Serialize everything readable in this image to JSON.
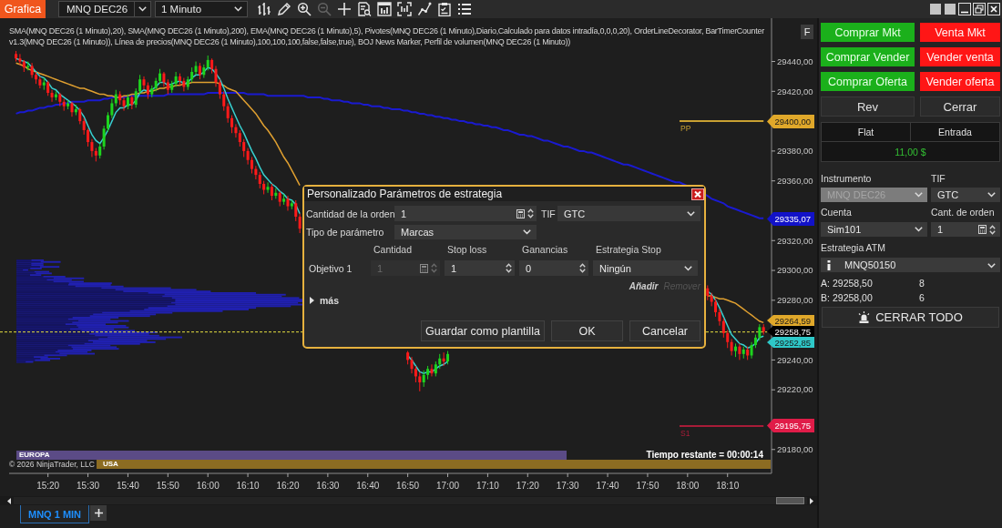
{
  "toolbar": {
    "tab": "Grafica",
    "instrument": "MNQ DEC26",
    "interval": "1 Minuto",
    "tools": [
      {
        "disabled": false
      },
      {
        "disabled": false
      },
      {
        "disabled": false
      },
      {
        "disabled": true
      },
      {
        "disabled": false
      },
      {
        "disabled": false
      },
      {
        "disabled": false
      },
      {
        "disabled": false
      },
      {
        "disabled": false
      },
      {
        "disabled": false
      },
      {
        "disabled": false
      }
    ]
  },
  "chart": {
    "indicators": "SMA(MNQ DEC26 (1 Minuto),20), SMA(MNQ DEC26 (1 Minuto),200), EMA(MNQ DEC26 (1 Minuto),5), Pivotes(MNQ DEC26 (1 Minuto),Diario,Calculado para datos intradía,0,0,0,20), OrderLineDecorator, BarTimerCounter v1.3(MNQ DEC26 (1 Minuto)), Línea de precios(MNQ DEC26 (1 Minuto),100,100,100,false,false,true), BOJ News Marker, Perfil de volumen(MNQ DEC26 (1 Minuto))",
    "panel_button": "F",
    "chart_data": {
      "type": "candlestick",
      "x": [
        912,
        913,
        914,
        915,
        916,
        917,
        918,
        919,
        920,
        921,
        922,
        923,
        924,
        925,
        926,
        927,
        928,
        929,
        930,
        931,
        932,
        933,
        934,
        935,
        936,
        937,
        938,
        939,
        940,
        941,
        942,
        943,
        944,
        945,
        946,
        947,
        948,
        949,
        950,
        951,
        952,
        953,
        954,
        955,
        956,
        957,
        958,
        959,
        960,
        961,
        962,
        963,
        964,
        965,
        966,
        967,
        968,
        969,
        970,
        971,
        972,
        973,
        974,
        975,
        976,
        977,
        978,
        979,
        980,
        981,
        982,
        983,
        984,
        985,
        986,
        987,
        988,
        989,
        990,
        991,
        992,
        993,
        994,
        995,
        996,
        997,
        998,
        999,
        1000,
        1001,
        1002,
        1003,
        1004,
        1005,
        1006,
        1007,
        1008,
        1009,
        1010,
        1011,
        1012,
        1013,
        1014,
        1015,
        1016,
        1017,
        1018,
        1019,
        1020,
        1021,
        1022,
        1023,
        1024,
        1025,
        1026,
        1027,
        1028,
        1029,
        1030,
        1031,
        1032,
        1033,
        1034,
        1035,
        1036,
        1037,
        1038,
        1039,
        1040,
        1041,
        1042,
        1043,
        1044,
        1045,
        1046,
        1047,
        1048,
        1049,
        1050,
        1051,
        1052,
        1053,
        1054,
        1055,
        1056,
        1057,
        1058,
        1059,
        1060,
        1061,
        1062,
        1063,
        1064,
        1065,
        1066,
        1067,
        1068,
        1069,
        1070,
        1071,
        1072,
        1073,
        1074,
        1075,
        1076,
        1077,
        1078,
        1085,
        1086,
        1087,
        1088,
        1089,
        1090,
        1091,
        1092,
        1093,
        1094,
        1095,
        1096,
        1097,
        1098,
        1099
      ],
      "ohlc": [
        [
          29445,
          29447,
          29440,
          29442
        ],
        [
          29442,
          29445,
          29438,
          29440
        ],
        [
          29440,
          29441,
          29433,
          29436
        ],
        [
          29436,
          29440,
          29434,
          29437
        ],
        [
          29437,
          29439,
          29429,
          29431
        ],
        [
          29431,
          29433,
          29425,
          29428
        ],
        [
          29428,
          29430,
          29422,
          29424
        ],
        [
          29424,
          29429,
          29421,
          29426
        ],
        [
          29426,
          29427,
          29417,
          29419
        ],
        [
          29419,
          29421,
          29413,
          29416
        ],
        [
          29416,
          29420,
          29414,
          29418
        ],
        [
          29418,
          29419,
          29410,
          29413
        ],
        [
          29413,
          29415,
          29407,
          29410
        ],
        [
          29410,
          29414,
          29408,
          29412
        ],
        [
          29412,
          29413,
          29403,
          29406
        ],
        [
          29406,
          29411,
          29404,
          29408
        ],
        [
          29408,
          29409,
          29398,
          29400
        ],
        [
          29400,
          29402,
          29391,
          29394
        ],
        [
          29394,
          29395,
          29383,
          29386
        ],
        [
          29386,
          29388,
          29376,
          29380
        ],
        [
          29380,
          29382,
          29373,
          29377
        ],
        [
          29377,
          29385,
          29375,
          29383
        ],
        [
          29383,
          29397,
          29381,
          29395
        ],
        [
          29395,
          29406,
          29393,
          29404
        ],
        [
          29404,
          29415,
          29402,
          29412
        ],
        [
          29412,
          29421,
          29410,
          29418
        ],
        [
          29418,
          29420,
          29411,
          29414
        ],
        [
          29414,
          29416,
          29407,
          29410
        ],
        [
          29410,
          29418,
          29408,
          29416
        ],
        [
          29416,
          29417,
          29408,
          29411
        ],
        [
          29411,
          29422,
          29409,
          29420
        ],
        [
          29420,
          29431,
          29418,
          29428
        ],
        [
          29428,
          29430,
          29421,
          29424
        ],
        [
          29424,
          29426,
          29415,
          29418
        ],
        [
          29418,
          29424,
          29416,
          29422
        ],
        [
          29422,
          29429,
          29420,
          29427
        ],
        [
          29427,
          29435,
          29425,
          29432
        ],
        [
          29432,
          29433,
          29423,
          29426
        ],
        [
          29426,
          29428,
          29418,
          29421
        ],
        [
          29421,
          29427,
          29419,
          29425
        ],
        [
          29425,
          29433,
          29423,
          29430
        ],
        [
          29430,
          29432,
          29424,
          29427
        ],
        [
          29427,
          29429,
          29420,
          29423
        ],
        [
          29423,
          29430,
          29421,
          29428
        ],
        [
          29428,
          29436,
          29426,
          29433
        ],
        [
          29433,
          29440,
          29431,
          29437
        ],
        [
          29437,
          29439,
          29428,
          29431
        ],
        [
          29431,
          29438,
          29429,
          29436
        ],
        [
          29436,
          29444,
          29434,
          29441
        ],
        [
          29441,
          29442,
          29432,
          29435
        ],
        [
          29435,
          29437,
          29423,
          29426
        ],
        [
          29426,
          29428,
          29415,
          29418
        ],
        [
          29418,
          29420,
          29407,
          29410
        ],
        [
          29410,
          29412,
          29399,
          29402
        ],
        [
          29402,
          29404,
          29392,
          29396
        ],
        [
          29396,
          29398,
          29389,
          29392
        ],
        [
          29392,
          29394,
          29383,
          29386
        ],
        [
          29386,
          29388,
          29376,
          29380
        ],
        [
          29380,
          29382,
          29371,
          29374
        ],
        [
          29374,
          29376,
          29365,
          29368
        ],
        [
          29368,
          29370,
          29361,
          29364
        ],
        [
          29364,
          29366,
          29355,
          29358
        ],
        [
          29358,
          29360,
          29351,
          29354
        ],
        [
          29354,
          29359,
          29352,
          29356
        ],
        [
          29356,
          29358,
          29347,
          29350
        ],
        [
          29350,
          29355,
          29348,
          29352
        ],
        [
          29352,
          29353,
          29343,
          29346
        ],
        [
          29346,
          29351,
          29344,
          29348
        ],
        [
          29348,
          29350,
          29340,
          29343
        ],
        [
          29343,
          29347,
          29341,
          29345
        ],
        [
          29345,
          29347,
          29333,
          29336
        ],
        [
          29336,
          29338,
          29325,
          29328
        ],
        null,
        null,
        null,
        null,
        null,
        null,
        null,
        null,
        null,
        null,
        null,
        null,
        null,
        null,
        null,
        null,
        null,
        null,
        null,
        null,
        null,
        null,
        null,
        null,
        null,
        null,
        [
          29245,
          29246,
          29237,
          29240
        ],
        [
          29240,
          29242,
          29231,
          29234
        ],
        [
          29234,
          29236,
          29225,
          29229
        ],
        [
          29229,
          29232,
          29219,
          29225
        ],
        [
          29225,
          29233,
          29222,
          29230
        ],
        [
          29230,
          29236,
          29227,
          29234
        ],
        [
          29234,
          29237,
          29229,
          29231
        ],
        [
          29231,
          29239,
          29229,
          29237
        ],
        [
          29237,
          29244,
          29234,
          29241
        ],
        [
          29241,
          29245,
          29236,
          29239
        ],
        [
          29239,
          29246,
          29237,
          29244
        ],
        null,
        null,
        null,
        null,
        null,
        null,
        null,
        null,
        null,
        null,
        null,
        null,
        null,
        null,
        null,
        null,
        null,
        null,
        null,
        null,
        null,
        null,
        null,
        null,
        null,
        null,
        null,
        null,
        null,
        null,
        null,
        null,
        null,
        null,
        null,
        null,
        null,
        null,
        null,
        null,
        null,
        null,
        null,
        null,
        null,
        null,
        null,
        null,
        null,
        null,
        null,
        null,
        null,
        null,
        null,
        null,
        null,
        null,
        [
          29288,
          29290,
          29280,
          29283
        ],
        [
          29283,
          29285,
          29276,
          29279
        ],
        [
          29279,
          29281,
          29269,
          29272
        ],
        [
          29272,
          29274,
          29263,
          29266
        ],
        [
          29266,
          29268,
          29255,
          29258
        ],
        [
          29258,
          29260,
          29248,
          29252
        ],
        [
          29252,
          29254,
          29243,
          29246
        ],
        [
          29246,
          29251,
          29242,
          29249
        ],
        [
          29249,
          29251,
          29240,
          29244
        ],
        [
          29244,
          29249,
          29241,
          29247
        ],
        [
          29247,
          29249,
          29240,
          29243
        ],
        [
          29243,
          29252,
          29241,
          29250
        ],
        [
          29250,
          29257,
          29248,
          29255
        ],
        [
          29255,
          29264,
          29253,
          29262
        ],
        [
          29262,
          29264,
          29257,
          29259
        ]
      ],
      "series": [
        {
          "type": "line",
          "color": "#1a1ad0",
          "values": [
            29405,
            29406,
            29406,
            29407,
            29407,
            29408,
            29409,
            29409,
            29410,
            29410,
            29411,
            29411,
            29412,
            29412,
            29413,
            29413,
            29413,
            29413,
            29414,
            29414,
            29414,
            29414,
            29415,
            29415,
            29416,
            29416,
            29416,
            29416,
            29417,
            29417,
            29417,
            29417,
            29417,
            29417,
            29417,
            29417,
            29417,
            29417,
            29418,
            29418,
            29418,
            29418,
            29418,
            29418,
            29418,
            29418,
            29418,
            29418,
            29419,
            29419,
            29419,
            29419,
            29419,
            29419,
            29419,
            29419,
            29419,
            29419,
            29418,
            29418,
            29418,
            29418,
            29418,
            29417,
            29417,
            29417,
            29417,
            29417,
            29417,
            29417,
            29417,
            29417,
            29417,
            29416,
            29416,
            29416,
            29416,
            29415,
            29415,
            29414,
            29414,
            29414,
            29413,
            29413,
            29412,
            29412,
            29412,
            29411,
            29411,
            29410,
            29410,
            29410,
            29409,
            29409,
            29408,
            29408,
            29408,
            29407,
            29407,
            29406,
            29406,
            29405,
            29405,
            29404,
            29404,
            29403,
            29403,
            29402,
            29402,
            29401,
            29401,
            29400,
            29400,
            29399,
            29399,
            29398,
            29398,
            29397,
            29397,
            29396,
            29396,
            29395,
            29394,
            29394,
            29393,
            29392,
            29391,
            29391,
            29390,
            29390,
            29389,
            29388,
            29387,
            29387,
            29386,
            29385,
            29384,
            29383,
            29383,
            29382,
            29381,
            29380,
            29380,
            29379,
            29379,
            29378,
            29377,
            29376,
            29375,
            29374,
            29373,
            29372,
            29371,
            29371,
            29370,
            29369,
            29368,
            29367,
            29366,
            29365,
            29364,
            29363,
            29362,
            29361,
            29360,
            29359,
            29359,
            29350,
            29348,
            29347,
            29346,
            29345,
            29343,
            29342,
            29341,
            29340,
            29339,
            29338,
            29337,
            29336,
            29335,
            29335
          ]
        },
        {
          "type": "line",
          "color": "#e0a030",
          "values": [
            29439,
            29438,
            29437,
            29435,
            29434,
            29433,
            29432,
            29431,
            29430,
            29429,
            29428,
            29427,
            29426,
            29425,
            29424,
            29423,
            29422,
            29422,
            29421,
            29420,
            29419,
            29418,
            29418,
            29417,
            29417,
            29416,
            29416,
            29417,
            29417,
            29418,
            29418,
            29419,
            29419,
            29420,
            29420,
            29421,
            29422,
            29422,
            29423,
            29423,
            29424,
            29424,
            29425,
            29425,
            29426,
            29426,
            29426,
            29426,
            29426,
            29426,
            29426,
            29425,
            29424,
            29422,
            29421,
            29420,
            29417,
            29414,
            29411,
            29408,
            29405,
            29401,
            29397,
            29394,
            29390,
            29386,
            29381,
            29376,
            29372,
            29367,
            29362,
            29357,
            null,
            null,
            null,
            null,
            null,
            null,
            null,
            null,
            null,
            null,
            null,
            null,
            null,
            null,
            null,
            null,
            null,
            null,
            null,
            null,
            null,
            null,
            null,
            null,
            null,
            null,
            null,
            null,
            null,
            null,
            null,
            null,
            null,
            null,
            null,
            null,
            null,
            null,
            null,
            null,
            null,
            null,
            null,
            null,
            null,
            null,
            null,
            null,
            null,
            null,
            null,
            null,
            null,
            null,
            null,
            null,
            null,
            null,
            null,
            null,
            null,
            null,
            null,
            null,
            null,
            null,
            null,
            null,
            null,
            null,
            null,
            null,
            null,
            null,
            null,
            null,
            null,
            null,
            null,
            null,
            null,
            null,
            null,
            null,
            null,
            null,
            null,
            null,
            null,
            null,
            null,
            null,
            null,
            null,
            null,
            29283,
            29283,
            29282,
            29281,
            29281,
            29280,
            29279,
            29278,
            29276,
            29274,
            29272,
            29270,
            29268,
            29266,
            29265
          ]
        },
        {
          "type": "line",
          "color": "#38d0d0",
          "values": [
            29442,
            29441,
            29440,
            29439,
            29436,
            29433,
            29430,
            29429,
            29426,
            29422,
            29421,
            29418,
            29416,
            29414,
            29412,
            29410,
            29407,
            29403,
            29397,
            29391,
            29387,
            29385,
            29389,
            29394,
            29400,
            29406,
            29409,
            29409,
            29411,
            29411,
            29414,
            29419,
            29421,
            29420,
            29421,
            29423,
            29426,
            29426,
            29424,
            29425,
            29426,
            29427,
            29425,
            29426,
            29429,
            29431,
            29431,
            29433,
            29436,
            29435,
            29432,
            29428,
            29422,
            29415,
            29409,
            29403,
            29397,
            29392,
            29386,
            29380,
            29375,
            29369,
            29364,
            29361,
            29358,
            29356,
            29353,
            29351,
            29348,
            29347,
            29344,
            29338,
            null,
            null,
            null,
            null,
            null,
            null,
            null,
            null,
            null,
            null,
            null,
            null,
            null,
            null,
            null,
            null,
            null,
            null,
            null,
            null,
            null,
            null,
            null,
            null,
            null,
            null,
            29243,
            29240,
            29236,
            29232,
            29231,
            29232,
            29232,
            29234,
            29236,
            29237,
            29239,
            null,
            null,
            null,
            null,
            null,
            null,
            null,
            null,
            null,
            null,
            null,
            null,
            null,
            null,
            null,
            null,
            null,
            null,
            null,
            null,
            null,
            null,
            null,
            null,
            null,
            null,
            null,
            null,
            null,
            null,
            null,
            null,
            null,
            null,
            null,
            null,
            null,
            null,
            null,
            null,
            null,
            null,
            null,
            null,
            null,
            null,
            null,
            null,
            null,
            null,
            null,
            null,
            null,
            null,
            null,
            null,
            null,
            null,
            29286,
            29284,
            29280,
            29275,
            29269,
            29263,
            29257,
            29254,
            29251,
            29250,
            29248,
            29249,
            29251,
            29255,
            29256
          ]
        }
      ],
      "ref_lines": [
        {
          "axis": "y",
          "value": 29400,
          "label": "PP",
          "color": "#c8a032"
        },
        {
          "axis": "y",
          "value": 29195.75,
          "label": "S1",
          "color": "#a81c38"
        },
        {
          "axis": "y",
          "value": 29258.75,
          "color": "#e6e040"
        }
      ],
      "xlim": [
        908,
        1101
      ],
      "ylim": [
        29164,
        29469
      ],
      "xticks": [
        {
          "value": 920,
          "label": "15:20"
        },
        {
          "value": 930,
          "label": "15:30"
        },
        {
          "value": 940,
          "label": "15:40"
        },
        {
          "value": 950,
          "label": "15:50"
        },
        {
          "value": 960,
          "label": "16:00"
        },
        {
          "value": 970,
          "label": "16:10"
        },
        {
          "value": 980,
          "label": "16:20"
        },
        {
          "value": 990,
          "label": "16:30"
        },
        {
          "value": 1000,
          "label": "16:40"
        },
        {
          "value": 1010,
          "label": "16:50"
        },
        {
          "value": 1020,
          "label": "17:00"
        },
        {
          "value": 1030,
          "label": "17:10"
        },
        {
          "value": 1040,
          "label": "17:20"
        },
        {
          "value": 1050,
          "label": "17:30"
        },
        {
          "value": 1060,
          "label": "17:40"
        },
        {
          "value": 1070,
          "label": "17:50"
        },
        {
          "value": 1080,
          "label": "18:00"
        },
        {
          "value": 1090,
          "label": "18:10"
        }
      ],
      "yticks": [
        {
          "value": 29440,
          "label": "29440,00"
        },
        {
          "value": 29420,
          "label": "29420,00"
        },
        {
          "value": 29380,
          "label": "29380,00"
        },
        {
          "value": 29360,
          "label": "29360,00"
        },
        {
          "value": 29320,
          "label": "29320,00"
        },
        {
          "value": 29300,
          "label": "29300,00"
        },
        {
          "value": 29280,
          "label": "29280,00"
        },
        {
          "value": 29240,
          "label": "29240,00"
        },
        {
          "value": 29220,
          "label": "29220,00"
        },
        {
          "value": 29180,
          "label": "29180,00"
        }
      ]
    },
    "price_markers": [
      {
        "label": "29400,00",
        "color": "#e0a82a"
      },
      {
        "label": "29335,07",
        "color": "#1212c8"
      },
      {
        "label": "29264,59",
        "color": "#e0a82a"
      },
      {
        "label": "29258,75",
        "color": "#000000"
      },
      {
        "label": "29252,85",
        "color": "#2ec8c8"
      },
      {
        "label": "29195,75",
        "color": "#e01c48"
      }
    ],
    "sessions": [
      {
        "label": "EUROPA",
        "color": "#5b4b86"
      },
      {
        "label": "USA",
        "color": "#8c6c22"
      }
    ],
    "copyright": "© 2026 NinjaTrader, LLC",
    "bar_timer": "Tiempo restante = 00:00:14"
  },
  "dialog": {
    "title": "Personalizado Parámetros de estrategia",
    "order_quantity": {
      "label": "Cantidad de la orden",
      "value": "1"
    },
    "tif": {
      "label": "TIF",
      "value": "GTC"
    },
    "parameter_type": {
      "label": "Tipo de parámetro",
      "value": "Marcas"
    },
    "target_columns": [
      "Cantidad",
      "Stop loss",
      "Ganancias",
      "Estrategia Stop"
    ],
    "targets": [
      {
        "label": "Objetivo 1",
        "quantity": "1",
        "quantity_disabled": true,
        "stop_loss": "1",
        "profit": "0",
        "stop_strategy": "Ningún"
      }
    ],
    "add": {
      "label": "Añadir",
      "disabled": false
    },
    "remove": {
      "label": "Remover",
      "disabled": true
    },
    "more": {
      "label": "más",
      "expanded": false
    },
    "buttons": [
      "Guardar como plantilla",
      "OK",
      "Cancelar"
    ]
  },
  "order_panel": {
    "buttons": [
      {
        "label": "Comprar Mkt",
        "kind": "buy"
      },
      {
        "label": "Venta Mkt",
        "kind": "sell"
      },
      {
        "label": "Comprar Vender",
        "kind": "buy"
      },
      {
        "label": "Vender venta",
        "kind": "sell"
      },
      {
        "label": "Comprar Oferta",
        "kind": "buy"
      },
      {
        "label": "Vender oferta",
        "kind": "sell"
      },
      {
        "label": "Rev",
        "kind": "neutral"
      },
      {
        "label": "Cerrar",
        "kind": "neutral"
      }
    ],
    "position": {
      "status": "Flat",
      "entry": "Entrada",
      "pnl": "11,00 $"
    },
    "instrument": {
      "label": "Instrumento",
      "value": "MNQ DEC26",
      "disabled": true
    },
    "tif": {
      "label": "TIF",
      "value": "GTC"
    },
    "account": {
      "label": "Cuenta",
      "value": "Sim101"
    },
    "quantity": {
      "label": "Cant. de orden",
      "value": "1"
    },
    "atm_strategy": {
      "label": "Estrategia ATM",
      "value": "MNQ50150"
    },
    "quotes": [
      {
        "side": "A:",
        "price": "29258,50",
        "size": "8"
      },
      {
        "side": "B:",
        "price": "29258,00",
        "size": "6"
      }
    ],
    "close_all": "CERRAR TODO"
  },
  "tabs": [
    {
      "label": "MNQ 1 MIN",
      "selected": true
    }
  ]
}
